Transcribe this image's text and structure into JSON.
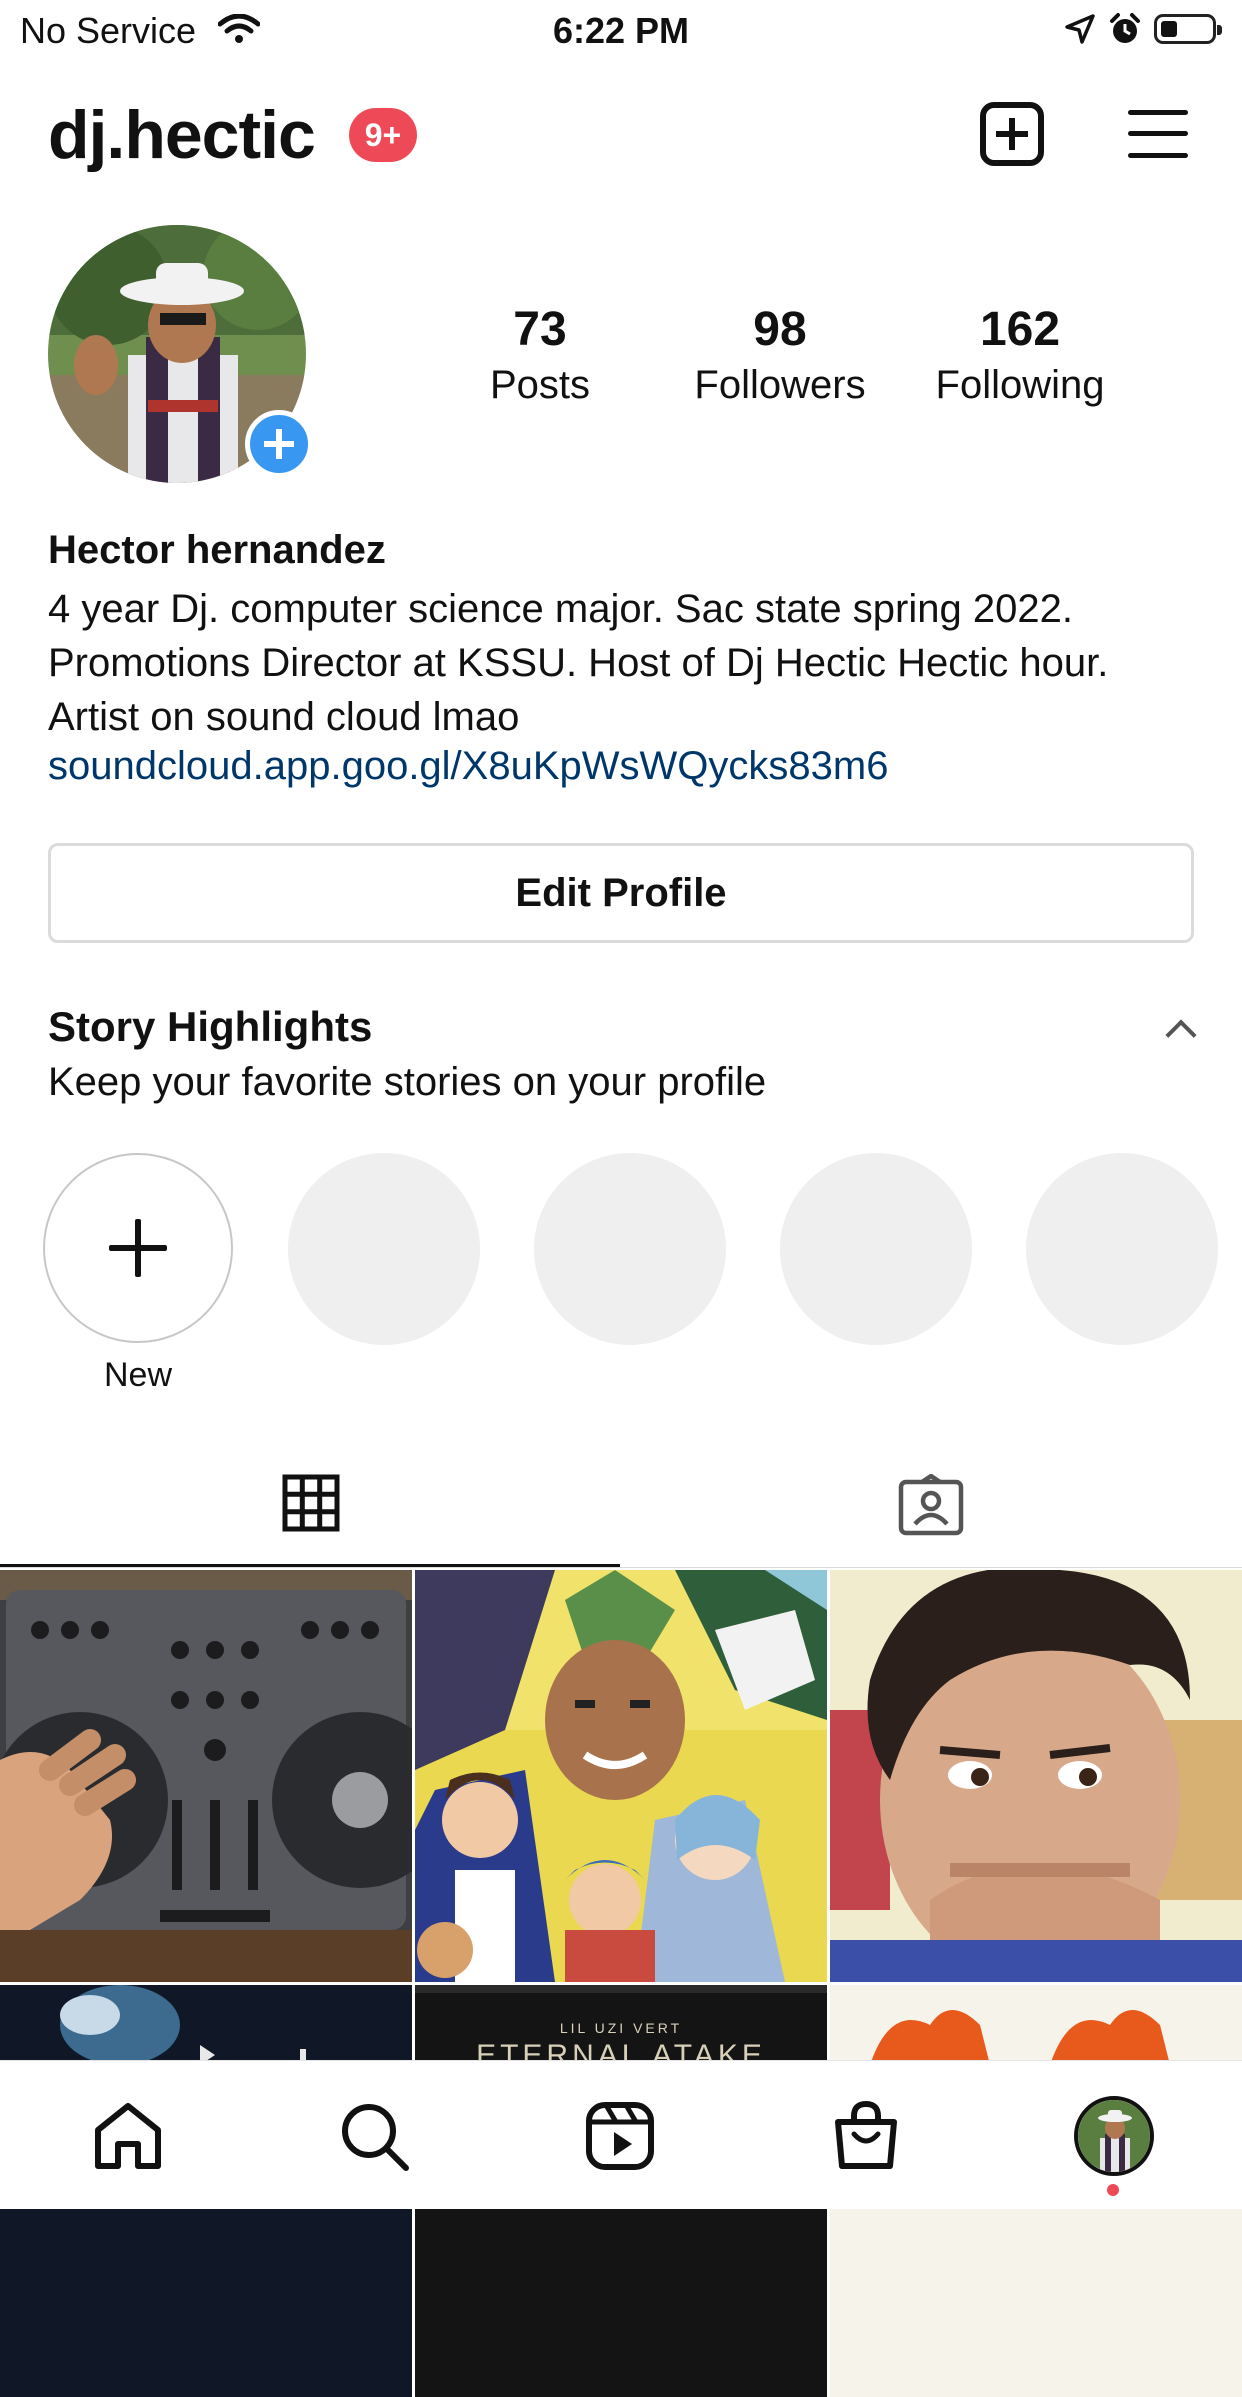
{
  "status_bar": {
    "carrier": "No Service",
    "time": "6:22 PM"
  },
  "header": {
    "username": "dj.hectic",
    "notification_badge": "9+"
  },
  "stats": [
    {
      "value": "73",
      "label": "Posts"
    },
    {
      "value": "98",
      "label": "Followers"
    },
    {
      "value": "162",
      "label": "Following"
    }
  ],
  "bio": {
    "name": "Hector hernandez",
    "text": "4 year Dj. computer science major. Sac state spring 2022. Promotions Director at KSSU. Host of Dj Hectic Hectic hour. Artist on sound cloud lmao",
    "link": "soundcloud.app.goo.gl/X8uKpWsWQycks83m6"
  },
  "edit_profile_label": "Edit Profile",
  "story_highlights": {
    "title": "Story Highlights",
    "subtitle": "Keep your favorite stories on your profile",
    "new_label": "New"
  },
  "grid": {
    "album_artist": "LIL UZI VERT",
    "album_title": "ETERNAL ATAKE"
  },
  "icons": {
    "header": [
      "plus-square-icon",
      "menu-icon"
    ],
    "tabs": [
      "grid-icon",
      "tagged-icon"
    ],
    "nav": [
      "home-icon",
      "search-icon",
      "reels-icon",
      "shop-icon",
      "profile-avatar"
    ]
  },
  "colors": {
    "badge": "#ed4956",
    "link": "#00376b",
    "avatar_add": "#3897f0",
    "placeholder": "#efefef"
  }
}
